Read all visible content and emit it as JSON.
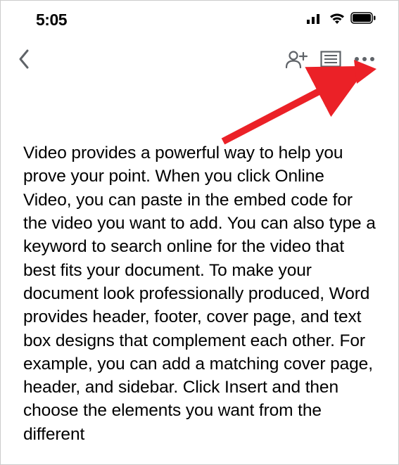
{
  "statusbar": {
    "time": "5:05"
  },
  "document": {
    "body": "Video provides a powerful way to help you prove your point. When you click Online Video, you can paste in the embed code for the video you want to add. You can also type a keyword to search online for the video that best fits your document. To make your document look professionally produced, Word provides header, footer, cover page, and text box designs that complement each other. For example, you can add a matching cover page, header, and sidebar. Click Insert and then choose the elements you want from the different"
  }
}
